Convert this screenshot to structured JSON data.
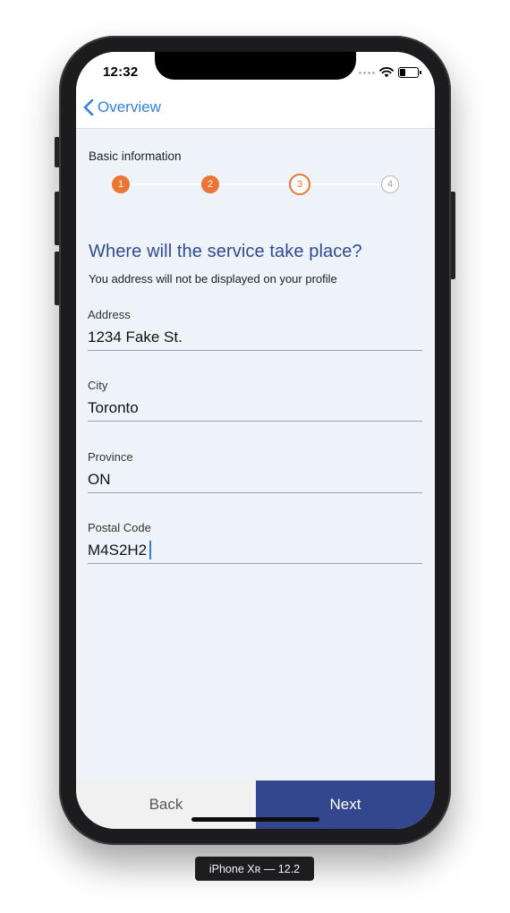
{
  "status_bar": {
    "time": "12:32"
  },
  "nav": {
    "back_label": "Overview",
    "back_icon": "chevron-left-icon"
  },
  "stepper": {
    "caption": "Basic information",
    "steps": [
      "1",
      "2",
      "3",
      "4"
    ],
    "current_step": 3,
    "total_steps": 4
  },
  "form": {
    "heading": "Where will the service take place?",
    "subheading": "You address will not be displayed on your profile",
    "fields": [
      {
        "label": "Address",
        "value": "1234 Fake St."
      },
      {
        "label": "City",
        "value": "Toronto"
      },
      {
        "label": "Province",
        "value": "ON"
      },
      {
        "label": "Postal Code",
        "value": "M4S2H2"
      }
    ]
  },
  "buttons": {
    "back": "Back",
    "next": "Next"
  },
  "device_caption": "iPhone Xʀ — 12.2",
  "colors": {
    "accent_blue": "#2f7ff0",
    "heading_blue": "#2f4a95",
    "step_orange": "#ee7431",
    "next_button": "#33478e",
    "screen_background": "#eef3fa"
  }
}
